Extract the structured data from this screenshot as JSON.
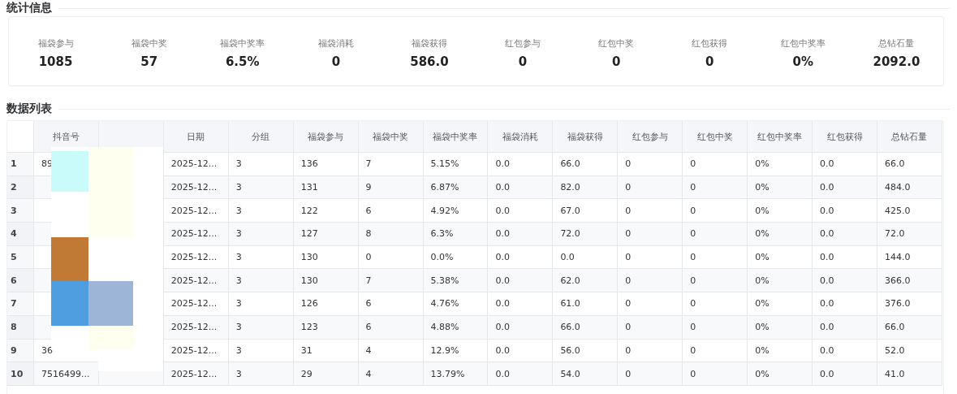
{
  "stats_section": {
    "title": "统计信息",
    "items": [
      {
        "label": "福袋参与",
        "value": "1085"
      },
      {
        "label": "福袋中奖",
        "value": "57"
      },
      {
        "label": "福袋中奖率",
        "value": "6.5%"
      },
      {
        "label": "福袋消耗",
        "value": "0"
      },
      {
        "label": "福袋获得",
        "value": "586.0"
      },
      {
        "label": "红包参与",
        "value": "0"
      },
      {
        "label": "红包中奖",
        "value": "0"
      },
      {
        "label": "红包获得",
        "value": "0"
      },
      {
        "label": "红包中奖率",
        "value": "0%"
      },
      {
        "label": "总钻石量",
        "value": "2092.0"
      }
    ]
  },
  "table_section": {
    "title": "数据列表",
    "columns": [
      "抖音号",
      "",
      "日期",
      "分组",
      "福袋参与",
      "福袋中奖",
      "福袋中奖率",
      "福袋消耗",
      "福袋获得",
      "红包参与",
      "红包中奖",
      "红包中奖率",
      "红包获得",
      "总钻石量"
    ],
    "rows": [
      {
        "index": "1",
        "cells": [
          "89",
          "",
          "2025-12...",
          "3",
          "136",
          "7",
          "5.15%",
          "0.0",
          "66.0",
          "0",
          "0",
          "0%",
          "0.0",
          "66.0"
        ]
      },
      {
        "index": "2",
        "cells": [
          "",
          "",
          "2025-12...",
          "3",
          "131",
          "9",
          "6.87%",
          "0.0",
          "82.0",
          "0",
          "0",
          "0%",
          "0.0",
          "484.0"
        ]
      },
      {
        "index": "3",
        "cells": [
          "",
          "",
          "2025-12...",
          "3",
          "122",
          "6",
          "4.92%",
          "0.0",
          "67.0",
          "0",
          "0",
          "0%",
          "0.0",
          "425.0"
        ]
      },
      {
        "index": "4",
        "cells": [
          "",
          "",
          "2025-12...",
          "3",
          "127",
          "8",
          "6.3%",
          "0.0",
          "72.0",
          "0",
          "0",
          "0%",
          "0.0",
          "72.0"
        ]
      },
      {
        "index": "5",
        "cells": [
          "",
          "",
          "2025-12...",
          "3",
          "130",
          "0",
          "0.0%",
          "0.0",
          "0.0",
          "0",
          "0",
          "0%",
          "0.0",
          "144.0"
        ]
      },
      {
        "index": "6",
        "cells": [
          "",
          "",
          "2025-12...",
          "3",
          "130",
          "7",
          "5.38%",
          "0.0",
          "62.0",
          "0",
          "0",
          "0%",
          "0.0",
          "366.0"
        ]
      },
      {
        "index": "7",
        "cells": [
          "",
          "",
          "2025-12...",
          "3",
          "126",
          "6",
          "4.76%",
          "0.0",
          "61.0",
          "0",
          "0",
          "0%",
          "0.0",
          "376.0"
        ]
      },
      {
        "index": "8",
        "cells": [
          "",
          "",
          "2025-12...",
          "3",
          "123",
          "6",
          "4.88%",
          "0.0",
          "66.0",
          "0",
          "0",
          "0%",
          "0.0",
          "66.0"
        ]
      },
      {
        "index": "9",
        "cells": [
          "36",
          "",
          "2025-12...",
          "3",
          "31",
          "4",
          "12.9%",
          "0.0",
          "56.0",
          "0",
          "0",
          "0%",
          "0.0",
          "52.0"
        ]
      },
      {
        "index": "10",
        "cells": [
          "7516499...",
          "",
          "2025-12...",
          "3",
          "29",
          "4",
          "13.79%",
          "0.0",
          "54.0",
          "0",
          "0",
          "0%",
          "0.0",
          "41.0"
        ]
      }
    ]
  }
}
